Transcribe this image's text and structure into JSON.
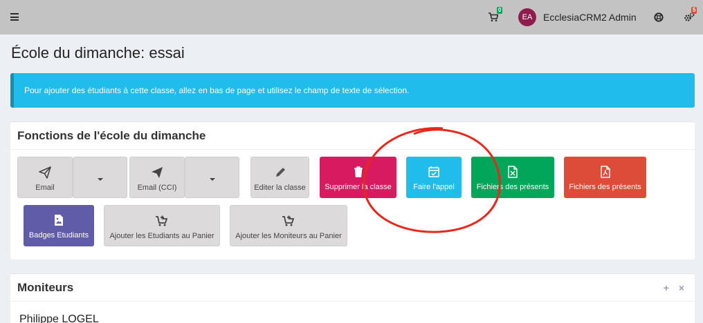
{
  "topbar": {
    "cart_count": "0",
    "avatar_initials": "EA",
    "username": "EcclesiaCRM2 Admin",
    "settings_badge": "5"
  },
  "page": {
    "title": "École du dimanche: essai"
  },
  "callout": {
    "text": "Pour ajouter des étudiants à cette classe, allez en bas de page et utilisez le champ de texte de sélection."
  },
  "functions_box": {
    "title": "Fonctions de l'école du dimanche",
    "buttons": {
      "email": "Email",
      "email_bcc": "Email (CCI)",
      "edit_class": "Editer la classe",
      "delete_class": "Supprimer la classe",
      "attendance": "Faire l'appel",
      "attendance_excel": "Fichiers des présents",
      "attendance_pdf": "Fichiers des présents",
      "student_badges": "Badges Etudiants",
      "add_students_cart": "Ajouter les Etudiants au Panier",
      "add_teachers_cart": "Ajouter les Moniteurs au Panier"
    }
  },
  "teachers_box": {
    "title": "Moniteurs",
    "tools": {
      "expand": "+",
      "close": "×"
    },
    "rows": [
      {
        "name": "Philippe LOGEL"
      }
    ]
  },
  "colors": {
    "topbar": "#c3c3c3",
    "info": "#21bdea",
    "maroon": "#d81b60",
    "success": "#00a65a",
    "danger": "#dd4b39",
    "purple": "#605ca8",
    "annotation": "#e8271c"
  },
  "icons": [
    "menu-icon",
    "cart-icon",
    "lifebuoy-icon",
    "gears-icon",
    "paper-plane-icon",
    "pencil-icon",
    "trash-icon",
    "calendar-check-icon",
    "file-excel-icon",
    "file-pdf-icon",
    "image-icon",
    "cart-plus-icon"
  ]
}
